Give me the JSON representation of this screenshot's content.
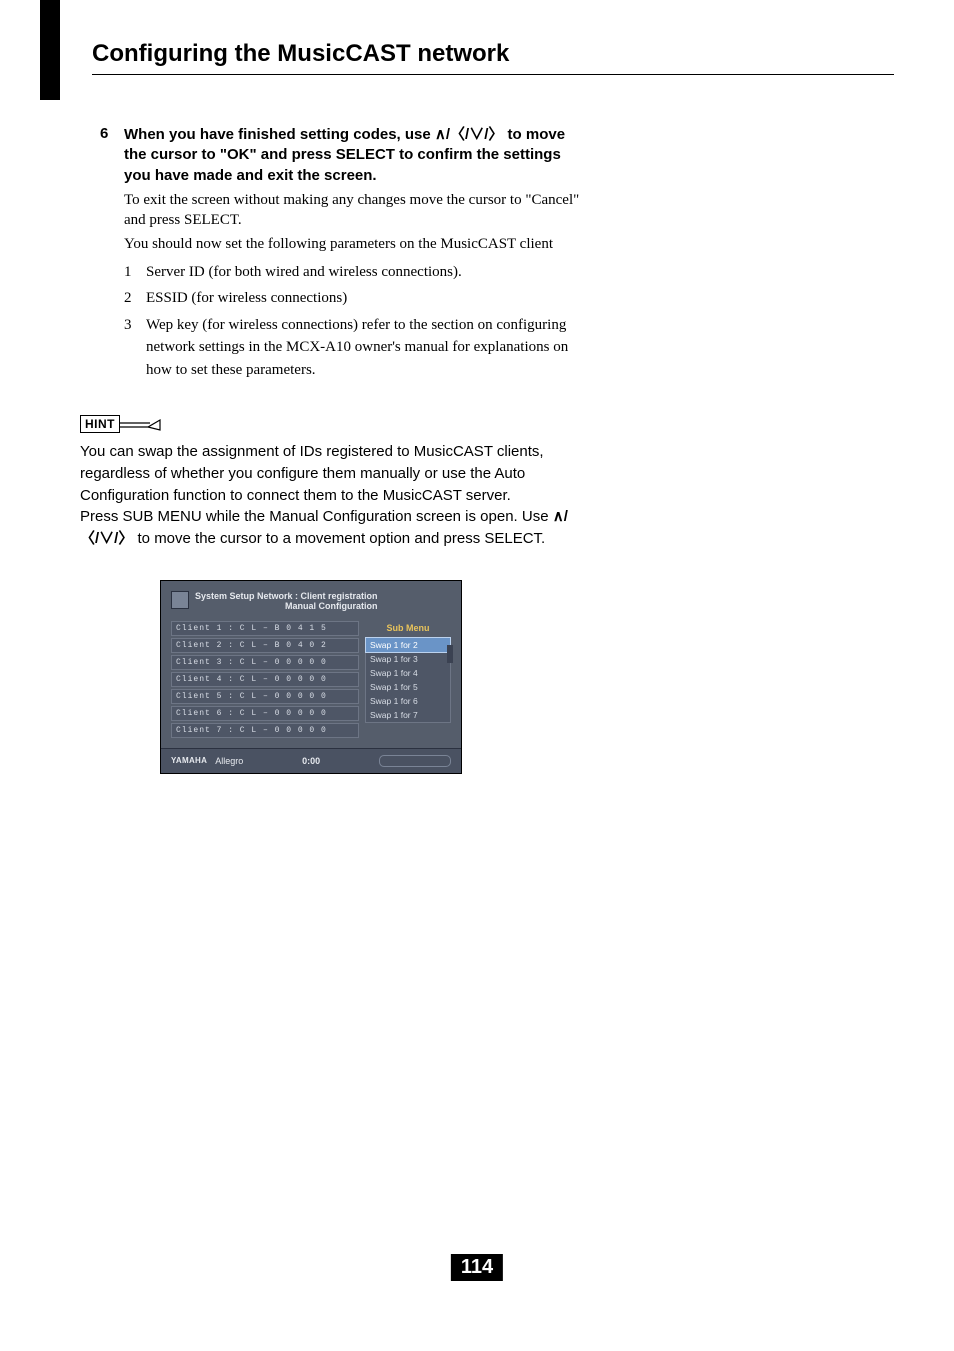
{
  "title": "Configuring the MusicCAST network",
  "step": {
    "number": "6",
    "bold_parts": [
      "When you have finished setting codes, use ",
      " to move the cursor to \"OK\" and press SELECT to confirm the settings you have made and exit the screen."
    ],
    "arrows_bold": "∧/〈/∨/〉",
    "para1": "To exit the screen without making any changes move the cursor to \"Cancel\" and press SELECT.",
    "para2": "You should now set the following parameters on the MusicCAST client",
    "items": [
      {
        "n": "1",
        "t": "Server ID (for both wired and wireless connections)."
      },
      {
        "n": "2",
        "t": "ESSID (for wireless connections)"
      },
      {
        "n": "3",
        "t": "Wep key (for wireless connections) refer to the section on configuring network settings in the MCX-A10 owner's manual for explanations on how to set these parameters."
      }
    ]
  },
  "hint": {
    "label": "HINT",
    "p1": "You can swap the assignment of IDs registered to MusicCAST clients, regardless of whether you configure them manually or use the Auto Configuration function to connect them to the MusicCAST server.",
    "p2a": "Press SUB MENU while the Manual Configuration screen is open. Use ",
    "arrows": "∧/〈/∨/〉",
    "p2b": " to move the cursor to a movement option and press SELECT."
  },
  "screenshot": {
    "breadcrumb_l1": "System Setup   Network : Client registration",
    "breadcrumb_l2": "Manual Configuration",
    "clients": [
      "Client 1 :  C  L  –  B  0  4  1  5",
      "Client 2 :  C  L  –  B  0  4  0  2",
      "Client 3 :  C  L  –  0  0  0  0  0",
      "Client 4 :  C  L  –  0  0  0  0  0",
      "Client 5 :  C  L  –  0  0  0  0  0",
      "Client 6 :  C  L  –  0  0  0  0  0",
      "Client 7 :  C  L  –  0  0  0  0  0"
    ],
    "submenu_title": "Sub Menu",
    "submenu_items": [
      "Swap 1 for 2",
      "Swap 1 for 3",
      "Swap 1 for 4",
      "Swap 1 for 5",
      "Swap 1 for 6",
      "Swap 1 for 7"
    ],
    "footer_brand": "YAMAHA",
    "footer_mode": "Allegro",
    "footer_time": "0:00"
  },
  "page_number": "114"
}
